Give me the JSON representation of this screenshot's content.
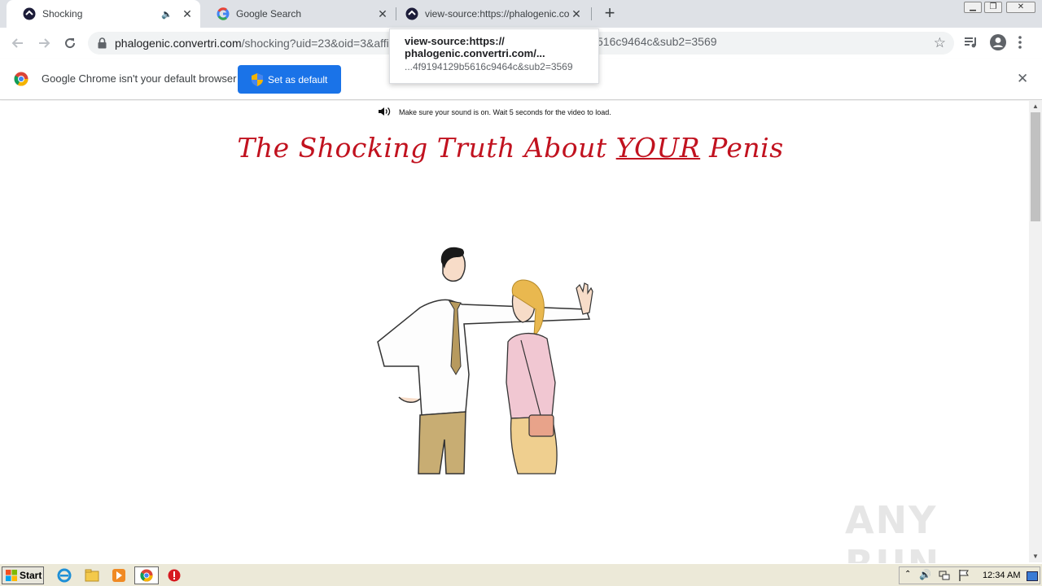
{
  "tabs": [
    {
      "title": "Shocking",
      "active": true
    },
    {
      "title": "Google Search",
      "active": false
    },
    {
      "title": "view-source:https://phalogenic.convertri.com/",
      "active": false
    }
  ],
  "new_tab_symbol": "+",
  "toolbar": {
    "url_host": "phalogenic.convertri.com",
    "url_path": "/shocking?uid=23&oid=3&affi",
    "url_tail": "516c9464c&sub2=3569"
  },
  "tooltip": {
    "line1": "view-source:https://",
    "line2": "phalogenic.convertri.com/...",
    "line3": "...4f9194129b5616c9464c&sub2=3569"
  },
  "infobar": {
    "message": "Google Chrome isn't your default browser",
    "button_label": "Set as default"
  },
  "page": {
    "sound_note": "Make sure your sound is on. Wait 5 seconds for the video to load.",
    "headline_pre": "The Shocking Truth About ",
    "headline_em": "YOUR",
    "headline_post": " Penis"
  },
  "watermark": "ANY RUN",
  "taskbar": {
    "start_label": "Start",
    "clock": "12:34 AM"
  },
  "colors": {
    "headline": "#c1121f",
    "primary_button": "#1a73e8",
    "tabstrip": "#dee1e6"
  }
}
